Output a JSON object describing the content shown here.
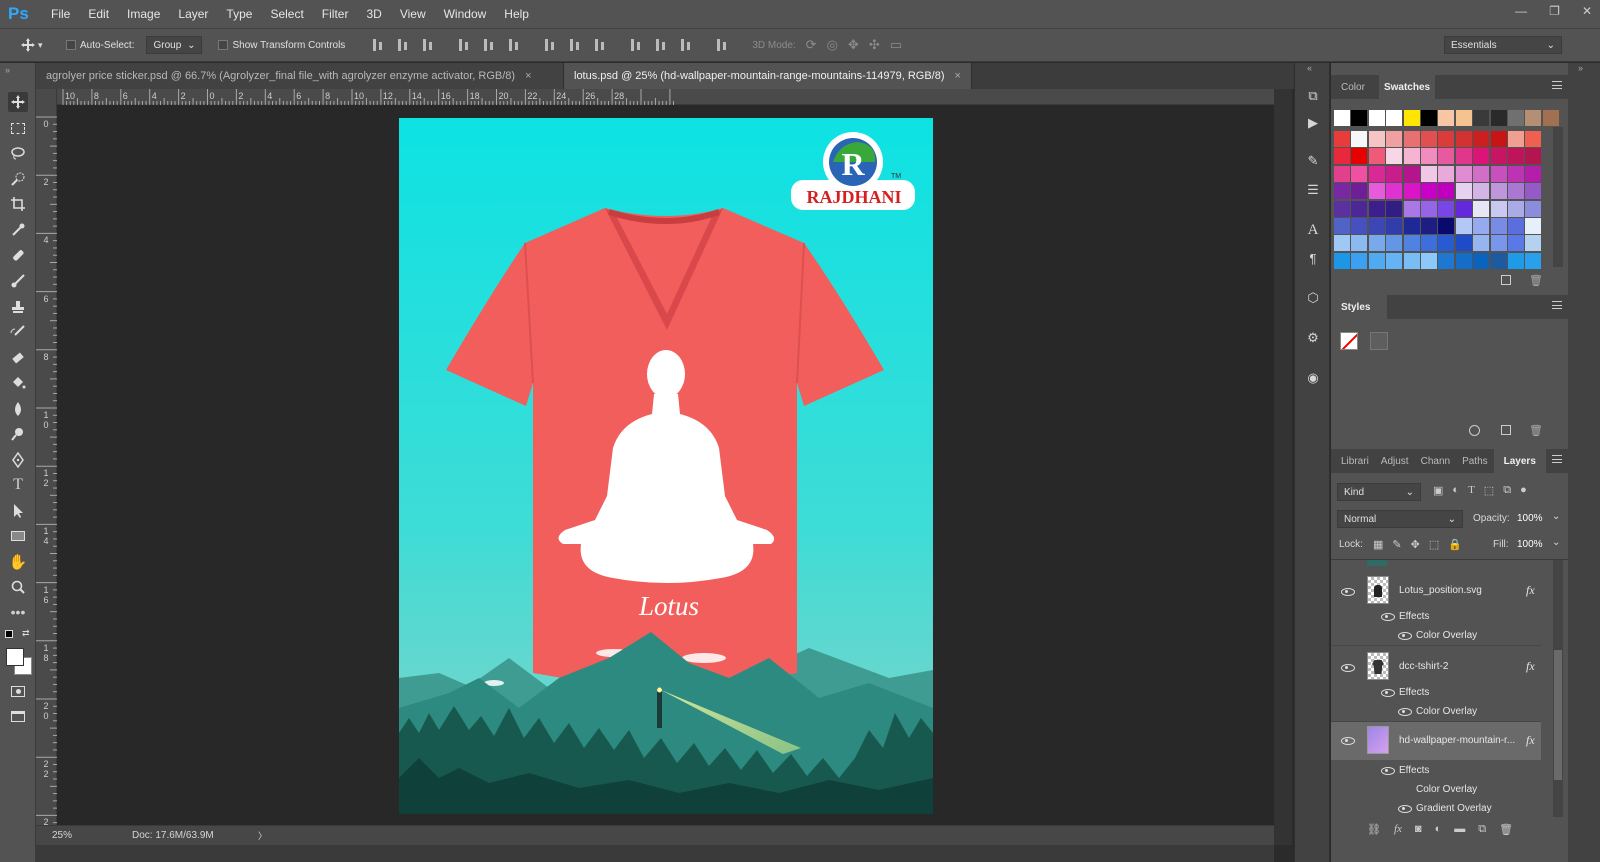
{
  "app": {
    "logo": "Ps"
  },
  "menu": [
    "File",
    "Edit",
    "Image",
    "Layer",
    "Type",
    "Select",
    "Filter",
    "3D",
    "View",
    "Window",
    "Help"
  ],
  "window_controls": {
    "minimize": "—",
    "restore": "❐",
    "close": "✕"
  },
  "options": {
    "auto_select_label": "Auto-Select:",
    "group_value": "Group",
    "show_transform_label": "Show Transform Controls",
    "mode3d_label": "3D Mode:",
    "workspace_value": "Essentials"
  },
  "tabs": [
    {
      "label": "agrolyer price sticker.psd @ 66.7% (Agrolyzer_final file_with agrolyzer enzyme activator, RGB/8)",
      "close": "×"
    },
    {
      "label": "lotus.psd @ 25% (hd-wallpaper-mountain-range-mountains-114979, RGB/8)",
      "close": "×"
    }
  ],
  "ruler_h": [
    "10",
    "8",
    "6",
    "4",
    "2",
    "0",
    "2",
    "4",
    "6",
    "8",
    "10",
    "12",
    "14",
    "16",
    "18",
    "20",
    "22",
    "24",
    "26",
    "28"
  ],
  "ruler_v": [
    "0",
    "2",
    "4",
    "6",
    "8",
    "1 0",
    "1 2",
    "1 4",
    "1 6",
    "1 8",
    "2 0",
    "2 2",
    "2"
  ],
  "canvas": {
    "brand": "RAJDHANI",
    "brand_mark": "R",
    "tm": "TM",
    "caption": "Lotus"
  },
  "status": {
    "zoom": "25%",
    "doc": "Doc: 17.6M/63.9M",
    "arrow": "〉"
  },
  "color_panel": {
    "tabs": [
      "Color",
      "Swatches"
    ]
  },
  "swatches": {
    "rows": [
      [
        "#ffffff",
        "#000000",
        "#ffffff",
        "#ffffff",
        "#ffe600",
        "#000000",
        "#f7c6a4",
        "#f5c38f",
        "#3a3a3a",
        "#2a2a2a",
        "#707070",
        "#b48f74",
        "#a07050"
      ],
      [
        "#e83c3c",
        "#f7f7f7",
        "#f5c4c4",
        "#f0a0a0",
        "#e97070",
        "#e05050",
        "#da3c3c",
        "#d23232",
        "#cc2020",
        "#c81414",
        "#f0a090",
        "#f06050"
      ],
      [
        "#e8283c",
        "#e60000",
        "#ee5a78",
        "#f7d6e6",
        "#f5b4d2",
        "#f08cbe",
        "#e85aa0",
        "#e0368c",
        "#dc1478",
        "#c81464",
        "#c0145a",
        "#b41450"
      ],
      [
        "#e0408c",
        "#f050a0",
        "#dc2896",
        "#c81e8c",
        "#b4148c",
        "#f0c8e6",
        "#e8aadc",
        "#e08cd2",
        "#d26ec8",
        "#c850be",
        "#be32b4",
        "#b41eaa"
      ],
      [
        "#7828a0",
        "#6e1e96",
        "#e65adc",
        "#e032d2",
        "#dc14c8",
        "#c800c8",
        "#be00be",
        "#e6d2f0",
        "#d2b4e6",
        "#be96dc",
        "#aa78d2",
        "#965ac8"
      ],
      [
        "#5a32a0",
        "#4b2896",
        "#3c1e8c",
        "#321e82",
        "#aa78e6",
        "#9664e6",
        "#7846e6",
        "#6428dc",
        "#e6e6f5",
        "#c8c8f0",
        "#aaaae6",
        "#8c8cdc"
      ],
      [
        "#5064c8",
        "#4650be",
        "#3c46b4",
        "#323caa",
        "#1e2896",
        "#1e1e82",
        "#0a0a6e",
        "#b4c8f5",
        "#96aaf0",
        "#788ce6",
        "#5a6edc",
        "#e6f0fa"
      ],
      [
        "#a0c8f5",
        "#8cbaf0",
        "#78aaeb",
        "#6496e6",
        "#5082e1",
        "#3c6edc",
        "#285ad2",
        "#1e4bc8",
        "#96b4f0",
        "#7896eb",
        "#5a78e6",
        "#b4d2f0"
      ],
      [
        "#1e96e6",
        "#3ca0f0",
        "#50aaf0",
        "#64b4f5",
        "#78bef5",
        "#8cc8fa",
        "#1e78d2",
        "#146ec8",
        "#0a64be",
        "#1e5aa0",
        "#1e9be6",
        "#28a0eb"
      ]
    ]
  },
  "styles_panel": {
    "title": "Styles"
  },
  "layers_panel": {
    "tabs": [
      "Librari",
      "Adjust",
      "Chann",
      "Paths",
      "Layers"
    ],
    "kind": "Kind",
    "blend": "Normal",
    "opacity_label": "Opacity:",
    "opacity": "100%",
    "lock_label": "Lock:",
    "fill_label": "Fill:",
    "fill": "100%",
    "layers": [
      {
        "name": "Lotus_position.svg",
        "fx": "fx",
        "effects_label": "Effects",
        "effects": [
          "Color Overlay"
        ]
      },
      {
        "name": "dcc-tshirt-2",
        "fx": "fx",
        "effects_label": "Effects",
        "effects": [
          "Color Overlay"
        ]
      },
      {
        "name": "hd-wallpaper-mountain-r...",
        "fx": "fx",
        "effects_label": "Effects",
        "effects": [
          "Color Overlay",
          "Gradient Overlay"
        ]
      }
    ]
  },
  "colors": {
    "ui_bg": "#535353",
    "dark_bg": "#282828",
    "accent": "#31a8ff",
    "shirt": "#f25e5c",
    "sky_top": "#0ee0e2",
    "sky_bottom": "#74d4cc",
    "mountain": "#2c8a80",
    "forest": "#124c45"
  }
}
